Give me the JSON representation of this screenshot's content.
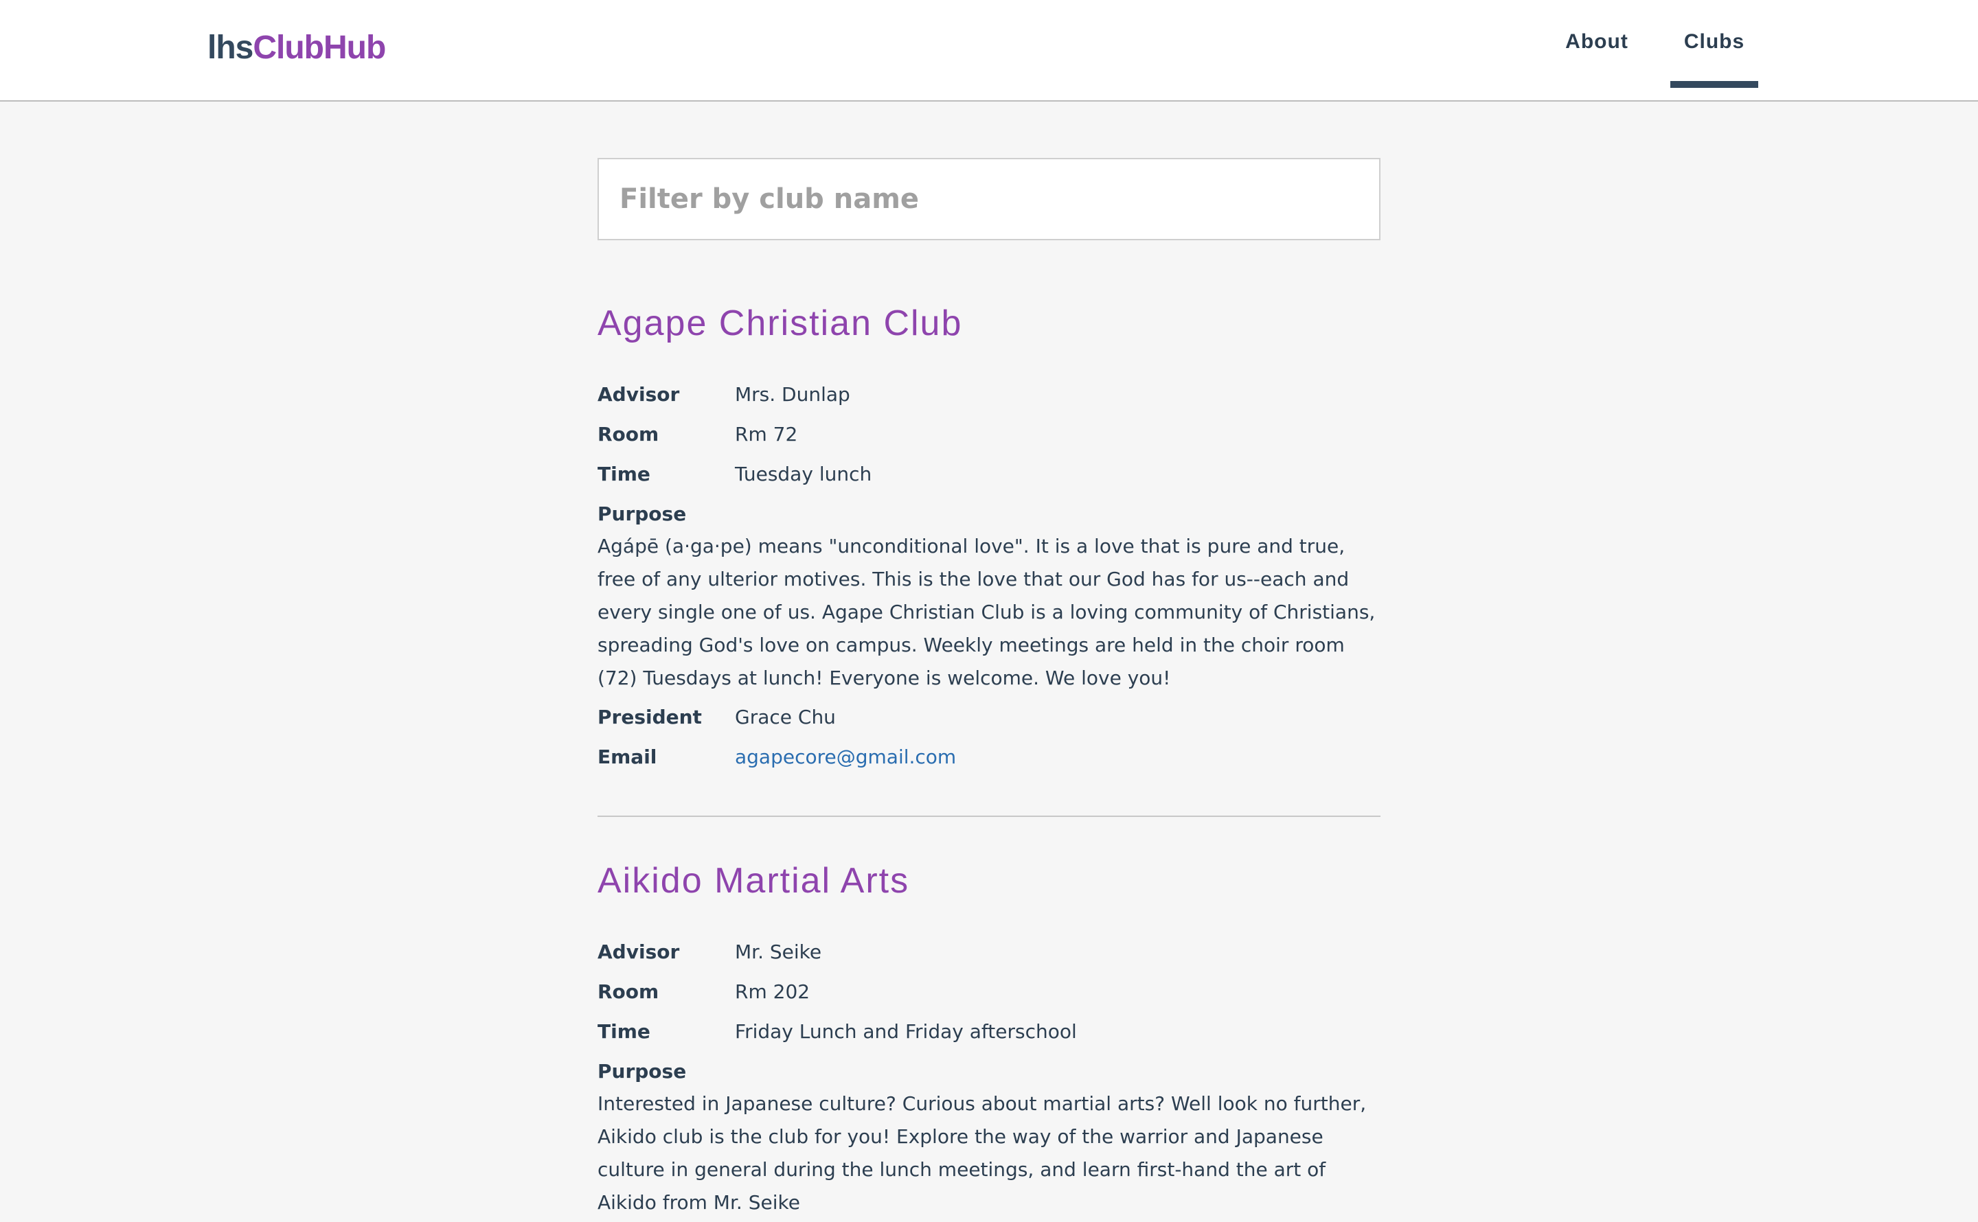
{
  "header": {
    "logo_prefix": "lhs",
    "logo_suffix": "ClubHub",
    "nav": {
      "about": "About",
      "clubs": "Clubs"
    },
    "active_nav": "Clubs"
  },
  "filter": {
    "placeholder": "Filter by club name",
    "value": ""
  },
  "labels": {
    "advisor": "Advisor",
    "room": "Room",
    "time": "Time",
    "purpose": "Purpose",
    "president": "President",
    "email": "Email"
  },
  "clubs": [
    {
      "name": "Agape Christian Club",
      "advisor": "Mrs. Dunlap",
      "room": "Rm 72",
      "time": "Tuesday lunch",
      "purpose": "Agápē (a·ga·pe) means \"unconditional love\". It is a love that is pure and true, free of any ulterior motives. This is the love that our God has for us--each and every single one of us. Agape Christian Club is a loving community of Christians, spreading God's love on campus. Weekly meetings are held in the choir room (72) Tuesdays at lunch! Everyone is welcome. We love you!",
      "president": "Grace Chu",
      "email": "agapecore@gmail.com"
    },
    {
      "name": "Aikido Martial Arts",
      "advisor": "Mr. Seike",
      "room": "Rm 202",
      "time": "Friday Lunch and Friday afterschool",
      "purpose": "Interested in Japanese culture? Curious about martial arts? Well look no further, Aikido club is the club for you! Explore the way of the warrior and Japanese culture in general during the lunch meetings, and learn first-hand the art of Aikido from Mr. Seike"
    }
  ],
  "colors": {
    "brand_purple": "#8e44ad",
    "brand_dark": "#34495e",
    "link_blue": "#2a6db0",
    "background": "#f6f6f6"
  }
}
